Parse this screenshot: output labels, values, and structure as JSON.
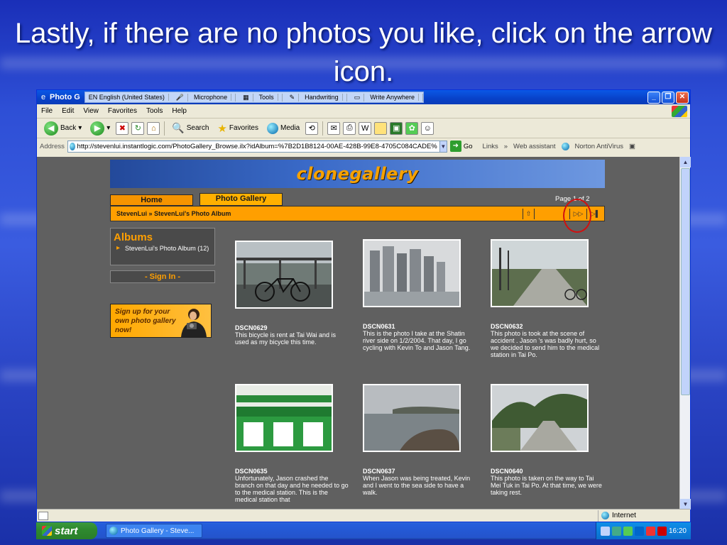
{
  "slide": {
    "title": "Lastly, if there are no photos you like, click on the arrow icon."
  },
  "window": {
    "title": "Photo G",
    "langbar": {
      "language": "EN English (United States)",
      "microphone": "Microphone",
      "tools": "Tools",
      "handwriting": "Handwriting",
      "write_anywhere": "Write Anywhere"
    }
  },
  "menu": {
    "items": [
      "File",
      "Edit",
      "View",
      "Favorites",
      "Tools",
      "Help"
    ]
  },
  "toolbar": {
    "back": "Back",
    "search": "Search",
    "favorites": "Favorites",
    "media": "Media"
  },
  "address": {
    "label": "Address",
    "url": "http://stevenlui.instantlogic.com/PhotoGallery_Browse.ilx?idAlbum=%7B2D1B8124-00AE-428B-99E8-4705C084CADE%",
    "go": "Go",
    "links": "Links",
    "web_assistant": "Web assistant",
    "norton": "Norton AntiVirus"
  },
  "gallery": {
    "logo": "clonegallery",
    "tabs": [
      "Home",
      "Photo Gallery"
    ],
    "page_indicator": "Page 1 of 2",
    "breadcrumb": "StevenLui » StevenLui's Photo Album",
    "albums_heading": "Albums",
    "album_link": "StevenLui's Photo Album (12)",
    "sign_in": "- Sign In -",
    "promo": "Sign up for your own photo gallery now!",
    "photos": [
      {
        "name": "DSCN0629",
        "desc": "This bicycle is rent at Tai Wai and is used as my bicycle this time."
      },
      {
        "name": "DSCN0631",
        "desc": "This is the photo I take at the Shatin river side on 1/2/2004. That day, I go cycling with Kevin To and Jason Tang."
      },
      {
        "name": "DSCN0632",
        "desc": "This photo is took at the scene of accident . Jason 's was badly hurt, so we decided to send him to the medical station in Tai Po."
      },
      {
        "name": "DSCN0635",
        "desc": "Unfortunately, Jason crashed the branch on that day and he needed to go to the medical station. This is the medical station that"
      },
      {
        "name": "DSCN0637",
        "desc": "When Jason was being treated, Kevin and I went to the sea side to have a walk."
      },
      {
        "name": "DSCN0640",
        "desc": "This photo is taken on the way to Tai Mei Tuk in Tai Po. At that time, we were taking rest."
      }
    ]
  },
  "status": {
    "zone": "Internet"
  },
  "taskbar": {
    "start": "start",
    "task": "Photo Gallery - Steve...",
    "clock": "16:20"
  }
}
